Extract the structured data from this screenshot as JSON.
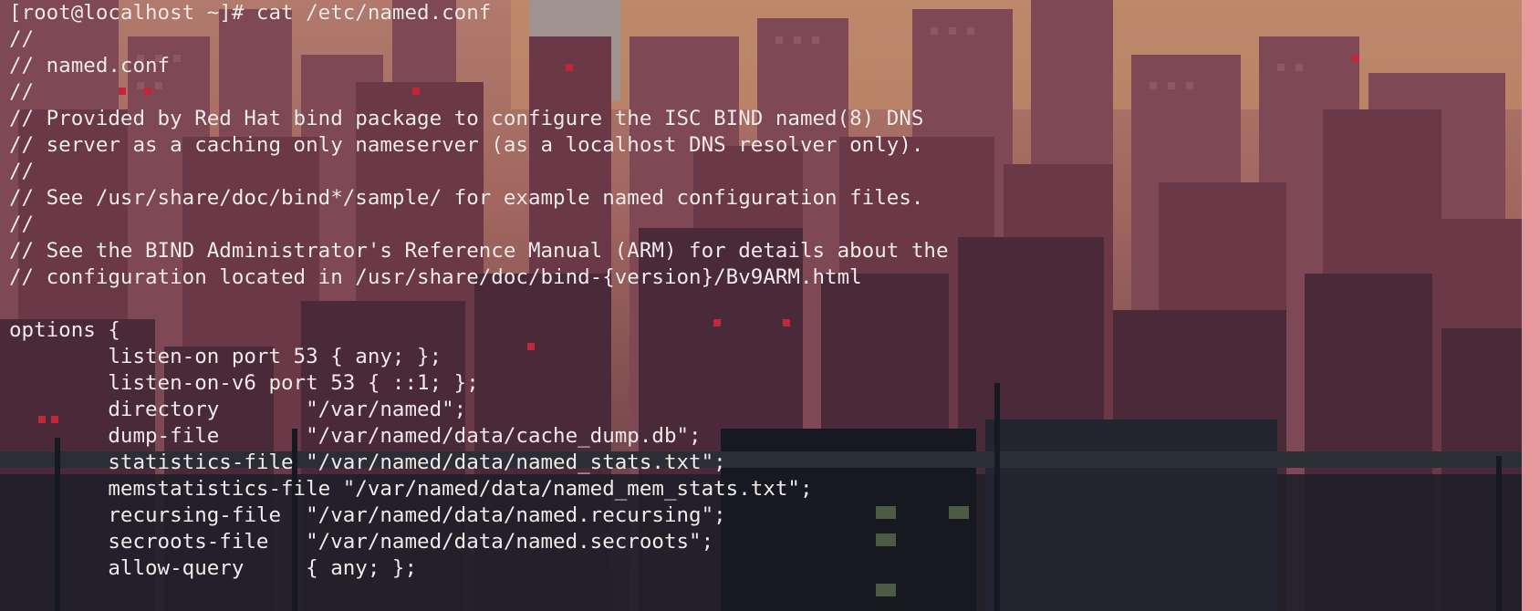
{
  "terminal": {
    "prompt": "[root@localhost ~]#",
    "command": "cat /etc/named.conf",
    "lines": [
      "[root@localhost ~]# cat /etc/named.conf",
      "//",
      "// named.conf",
      "//",
      "// Provided by Red Hat bind package to configure the ISC BIND named(8) DNS",
      "// server as a caching only nameserver (as a localhost DNS resolver only).",
      "//",
      "// See /usr/share/doc/bind*/sample/ for example named configuration files.",
      "//",
      "// See the BIND Administrator's Reference Manual (ARM) for details about the",
      "// configuration located in /usr/share/doc/bind-{version}/Bv9ARM.html",
      "",
      "options {",
      "        listen-on port 53 { any; };",
      "        listen-on-v6 port 53 { ::1; };",
      "        directory       \"/var/named\";",
      "        dump-file       \"/var/named/data/cache_dump.db\";",
      "        statistics-file \"/var/named/data/named_stats.txt\";",
      "        memstatistics-file \"/var/named/data/named_mem_stats.txt\";",
      "        recursing-file  \"/var/named/data/named.recursing\";",
      "        secroots-file   \"/var/named/data/named.secroots\";",
      "        allow-query     { any; };",
      ""
    ]
  },
  "colors": {
    "text": "#f2ebea",
    "sky": "#c98a6d",
    "building_dark": "#3b2a35",
    "building_mid": "#6e3d4a",
    "foreground": "#131a1f"
  }
}
